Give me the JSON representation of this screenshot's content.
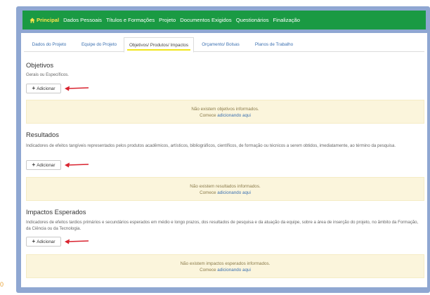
{
  "nav": {
    "items": [
      "Principal",
      "Dados Pessoais",
      "Títulos e Formações",
      "Projeto",
      "Documentos Exigidos",
      "Questionários",
      "Finalização"
    ]
  },
  "tabs": [
    "Dados do Projeto",
    "Equipe do Projeto",
    "Objetivos/ Produtos/ Impactos",
    "Orçamento/ Bolsas",
    "Planos de Trabalho"
  ],
  "sections": {
    "objetivos": {
      "title": "Objetivos",
      "desc": "Gerais ou Específicos.",
      "button": "Adicionar",
      "empty": "Não existem objetivos informados.",
      "start_prefix": "Comece",
      "start_link": "adicionando aqui"
    },
    "resultados": {
      "title": "Resultados",
      "desc": "Indicadores de efeitos tangíveis representados pelos produtos acadêmicos, artísticos, bibliográficos, científicos, de formação ou técnicos a serem obtidos, imediatamente, ao término da pesquisa.",
      "button": "Adicionar",
      "empty": "Não existem resultados informados.",
      "start_prefix": "Comece",
      "start_link": "adicionando aqui"
    },
    "impactos": {
      "title": "Impactos Esperados",
      "desc": "Indicadores de efeitos tardios primários e secundários esperados em médio e longo prazos, dos resultados de pesquisa e da atuação da equipe, sobre a área de inserção do projeto, no âmbito da Formação, da Ciência ou da Tecnologia.",
      "button": "Adicionar",
      "empty": "Não existem impactos esperados informados.",
      "start_prefix": "Comece",
      "start_link": "adicionando aqui"
    }
  },
  "corner_mark": "0",
  "colors": {
    "navbar": "#1a9a43",
    "principal": "#ffe64a",
    "highlight": "#f2e61a",
    "arrow": "#d9232f",
    "notice_bg": "#fbf5dc",
    "frame": "#8fa7d2"
  }
}
